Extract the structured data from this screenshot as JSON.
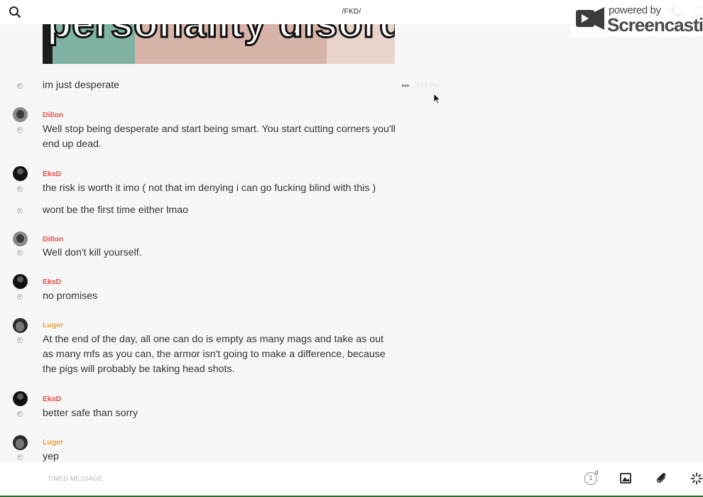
{
  "header": {
    "title": "/FKD/",
    "search_icon": "search-icon",
    "call_icon": "phone-icon",
    "info_icon": "info-icon"
  },
  "watermark": {
    "small": "powered by",
    "big": "Screencastify"
  },
  "image_preview": {
    "text": "personality disorder"
  },
  "hover_message": {
    "menu_label": "•••",
    "time": "3:58 PM"
  },
  "messages": [
    {
      "sender": "",
      "text": "im just desperate"
    },
    {
      "sender": "Dillon",
      "text": "Well stop being desperate and start being smart. You start cutting corners you'll end up dead."
    },
    {
      "sender": "EksD",
      "text": "the risk is worth it imo ( not that im denying i can go fucking blind with this )"
    },
    {
      "sender": "",
      "text": "wont be the first time either lmao"
    },
    {
      "sender": "Dillon",
      "text": "Well don't kill yourself."
    },
    {
      "sender": "EksD",
      "text": "no promises"
    },
    {
      "sender": "Luger",
      "text": "At the end of the day, all one can do is empty as many mags and take as out as many mfs as you can, the armor isn't going to make a difference, because the pigs will probably be taking head shots."
    },
    {
      "sender": "EksD",
      "text": "better safe than sorry"
    },
    {
      "sender": "Luger",
      "text": "yep"
    }
  ],
  "colors": {
    "dillon": "#e0514a",
    "eksd": "#e0514a",
    "luger": "#e8a33d"
  },
  "composer": {
    "timed_message_label": "TIMED MESSAGE",
    "timer_value": "1",
    "timer_unit": "d",
    "image_icon": "image-icon",
    "attach_icon": "paperclip-icon",
    "spinner_icon": "sparkle-icon"
  }
}
